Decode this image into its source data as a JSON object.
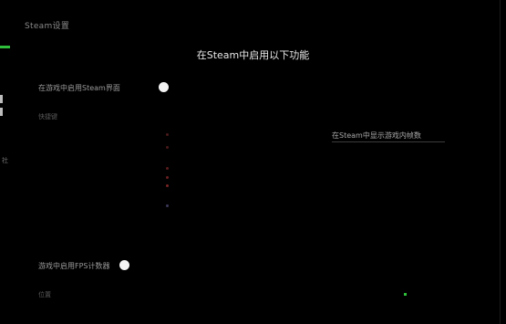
{
  "window": {
    "title": "Steam设置"
  },
  "header": {
    "title": "在Steam中启用以下功能"
  },
  "left_tag": "社",
  "settings": [
    {
      "label": "在游戏中启用Steam界面",
      "sub_label": "快捷键"
    },
    {
      "label": "游戏中启用FPS计数器",
      "sub_label": "位置"
    }
  ],
  "link": {
    "text": "在Steam中显示游戏内帧数"
  },
  "colors": {
    "accent_green": "#2fbf3a",
    "toggle_on": "#f4f4f4"
  }
}
